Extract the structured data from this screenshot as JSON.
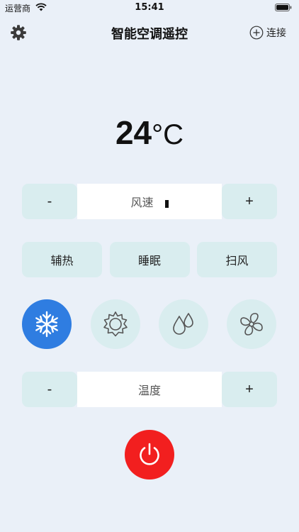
{
  "status_bar": {
    "carrier": "运营商",
    "time": "15:41"
  },
  "header": {
    "title": "智能空调遥控",
    "connect_label": "连接"
  },
  "temperature": {
    "value": "24",
    "unit": "°C"
  },
  "fan_speed": {
    "label": "风速",
    "minus": "-",
    "plus": "+"
  },
  "toggles": [
    {
      "label": "辅热"
    },
    {
      "label": "睡眠"
    },
    {
      "label": "扫风"
    }
  ],
  "modes": [
    {
      "icon": "snowflake-icon",
      "active": true
    },
    {
      "icon": "sun-icon",
      "active": false
    },
    {
      "icon": "water-drops-icon",
      "active": false
    },
    {
      "icon": "fan-icon",
      "active": false
    }
  ],
  "temp_control": {
    "label": "温度",
    "minus": "-",
    "plus": "+"
  },
  "colors": {
    "background": "#eaf0f8",
    "button_fill": "#d9edef",
    "active_mode": "#2f7de1",
    "power": "#f21f1f"
  }
}
